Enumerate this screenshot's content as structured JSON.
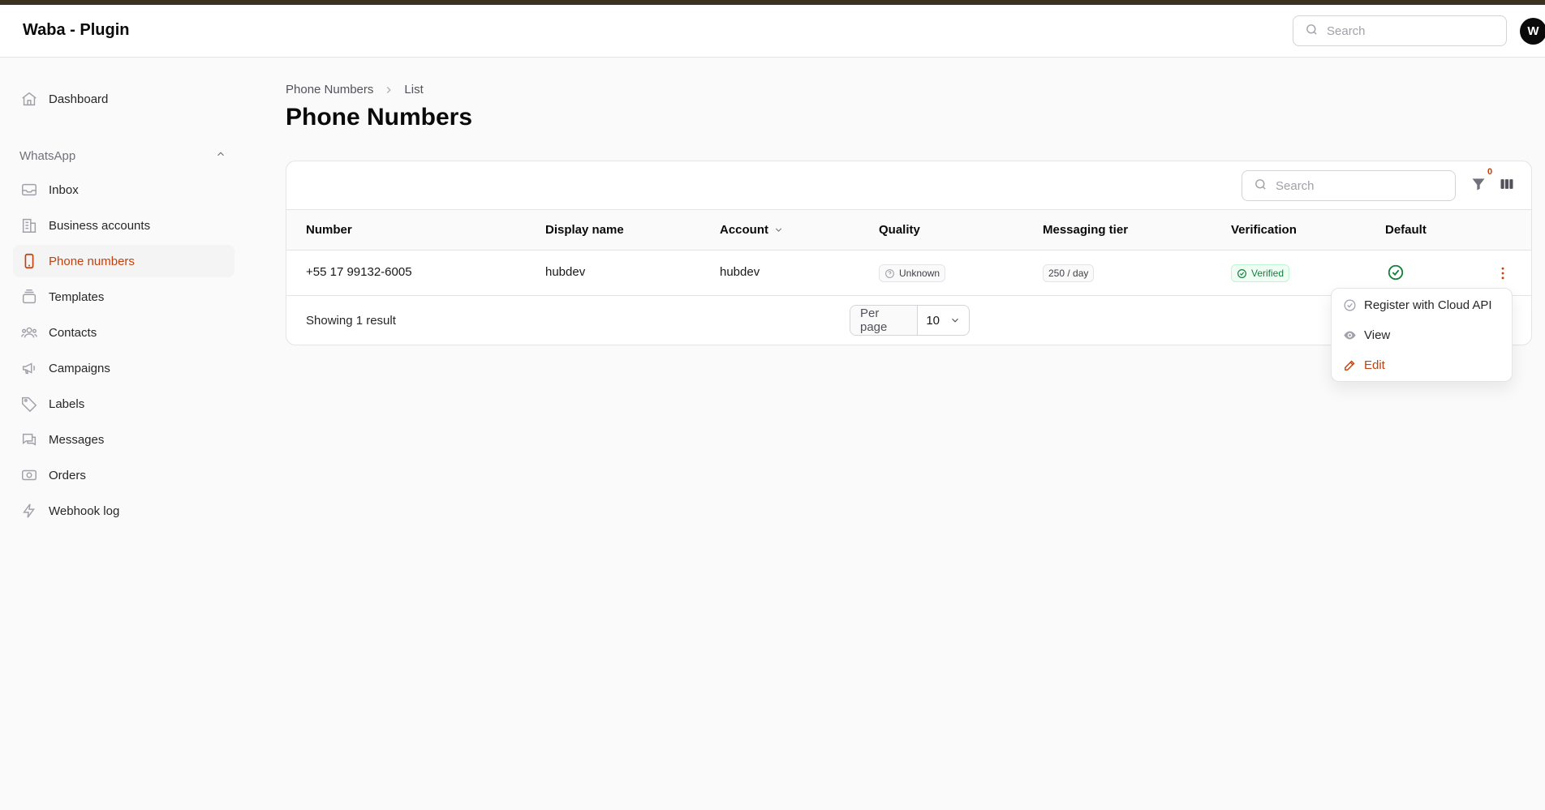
{
  "app": {
    "title": "Waba - Plugin",
    "user_initial": "W"
  },
  "topbar": {
    "search_placeholder": "Search"
  },
  "sidebar": {
    "dashboard": "Dashboard",
    "group_label": "WhatsApp",
    "items": [
      {
        "label": "Inbox",
        "icon": "inbox-icon"
      },
      {
        "label": "Business accounts",
        "icon": "building-icon"
      },
      {
        "label": "Phone numbers",
        "icon": "phone-icon",
        "active": true
      },
      {
        "label": "Templates",
        "icon": "templates-icon"
      },
      {
        "label": "Contacts",
        "icon": "users-icon"
      },
      {
        "label": "Campaigns",
        "icon": "megaphone-icon"
      },
      {
        "label": "Labels",
        "icon": "tag-icon"
      },
      {
        "label": "Messages",
        "icon": "chat-icon"
      },
      {
        "label": "Orders",
        "icon": "cash-icon"
      },
      {
        "label": "Webhook log",
        "icon": "bolt-icon"
      }
    ]
  },
  "breadcrumb": {
    "parent": "Phone Numbers",
    "current": "List"
  },
  "page": {
    "title": "Phone Numbers"
  },
  "table": {
    "search_placeholder": "Search",
    "filter_count": "0",
    "columns": [
      "Number",
      "Display name",
      "Account",
      "Quality",
      "Messaging tier",
      "Verification",
      "Default"
    ],
    "rows": [
      {
        "number": "+55 17 99132-6005",
        "display_name": "hubdev",
        "account": "hubdev",
        "quality": "Unknown",
        "messaging_tier": "250 / day",
        "verification": "Verified"
      }
    ],
    "showing": "Showing 1 result",
    "per_page_label": "Per page",
    "per_page_value": "10"
  },
  "row_actions": {
    "items": [
      "Register with Cloud API",
      "View",
      "Edit"
    ]
  },
  "colors": {
    "accent": "#c2410c",
    "success": "#15803d",
    "stripe": "#3b3222"
  }
}
